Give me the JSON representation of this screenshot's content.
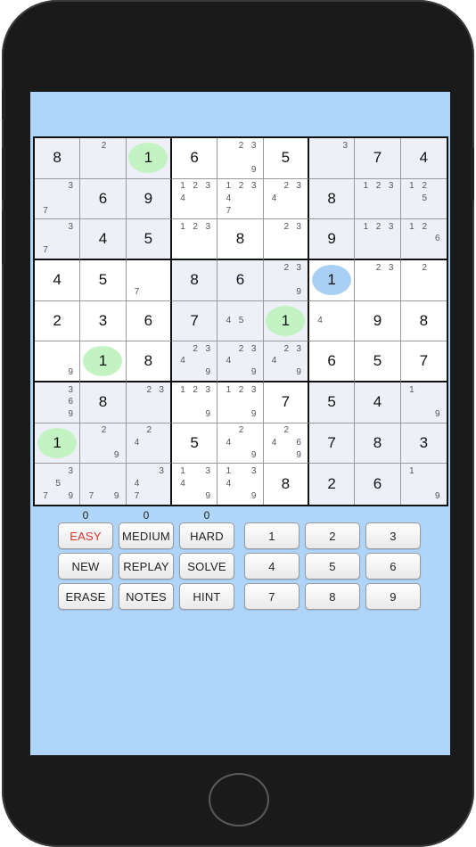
{
  "puzzle": {
    "rows": [
      [
        {
          "v": "8",
          "s": 1
        },
        {
          "n": [
            "",
            "2",
            "",
            "",
            "",
            "",
            "",
            "",
            ""
          ],
          "s": 1
        },
        {
          "v": "1",
          "h": "green",
          "s": 1
        },
        {
          "v": "6"
        },
        {
          "n": [
            "",
            "2",
            "3",
            "",
            "",
            "",
            "",
            "",
            "9"
          ]
        },
        {
          "v": "5"
        },
        {
          "n": [
            "",
            "",
            "3",
            "",
            "",
            "",
            "",
            "",
            ""
          ],
          "s": 1
        },
        {
          "v": "7",
          "s": 1
        },
        {
          "v": "4",
          "s": 1
        }
      ],
      [
        {
          "n": [
            "",
            "",
            "3",
            "",
            "",
            "",
            "7",
            "",
            ""
          ],
          "s": 1
        },
        {
          "v": "6",
          "s": 1
        },
        {
          "v": "9",
          "s": 1
        },
        {
          "n": [
            "1",
            "2",
            "3",
            "4",
            "",
            "",
            "",
            "",
            ""
          ]
        },
        {
          "n": [
            "1",
            "2",
            "3",
            "4",
            "",
            "",
            "7",
            "",
            ""
          ]
        },
        {
          "n": [
            "",
            "2",
            "3",
            "4",
            "",
            "",
            "",
            "",
            ""
          ]
        },
        {
          "v": "8",
          "s": 1
        },
        {
          "n": [
            "1",
            "2",
            "3",
            "",
            "",
            "",
            "",
            "",
            ""
          ],
          "s": 1
        },
        {
          "n": [
            "1",
            "2",
            "",
            "",
            "5",
            "",
            "",
            "",
            ""
          ],
          "s": 1
        }
      ],
      [
        {
          "n": [
            "",
            "",
            "3",
            "",
            "",
            "",
            "7",
            "",
            ""
          ],
          "s": 1
        },
        {
          "v": "4",
          "s": 1
        },
        {
          "v": "5",
          "s": 1
        },
        {
          "n": [
            "1",
            "2",
            "3",
            "",
            "",
            "",
            "",
            "",
            ""
          ]
        },
        {
          "v": "8"
        },
        {
          "n": [
            "",
            "2",
            "3",
            "",
            "",
            "",
            "",
            "",
            ""
          ]
        },
        {
          "v": "9",
          "s": 1
        },
        {
          "n": [
            "1",
            "2",
            "3",
            "",
            "",
            "",
            "",
            "",
            ""
          ],
          "s": 1
        },
        {
          "n": [
            "1",
            "2",
            "",
            "",
            "",
            "6",
            "",
            "",
            ""
          ],
          "s": 1
        }
      ],
      [
        {
          "v": "4"
        },
        {
          "v": "5"
        },
        {
          "n": [
            "",
            "",
            "",
            "",
            "",
            "",
            "7",
            "",
            ""
          ]
        },
        {
          "v": "8",
          "s": 1
        },
        {
          "v": "6",
          "s": 1
        },
        {
          "n": [
            "",
            "2",
            "3",
            "",
            "",
            "",
            "",
            "",
            "9"
          ],
          "s": 1
        },
        {
          "v": "1",
          "h": "blue"
        },
        {
          "n": [
            "",
            "2",
            "3",
            "",
            "",
            "",
            "",
            "",
            ""
          ]
        },
        {
          "n": [
            "",
            "2",
            "",
            "",
            "",
            "",
            "",
            "",
            ""
          ]
        }
      ],
      [
        {
          "v": "2"
        },
        {
          "v": "3"
        },
        {
          "v": "6"
        },
        {
          "v": "7",
          "s": 1
        },
        {
          "n": [
            "",
            "",
            "",
            "4",
            "5",
            "",
            "",
            "",
            ""
          ],
          "s": 1
        },
        {
          "v": "1",
          "h": "green",
          "s": 1
        },
        {
          "n": [
            "",
            "",
            "",
            "4",
            "",
            "",
            "",
            "",
            ""
          ]
        },
        {
          "v": "9"
        },
        {
          "v": "8"
        }
      ],
      [
        {
          "n": [
            "",
            "",
            "",
            "",
            "",
            "",
            "",
            "",
            "9"
          ]
        },
        {
          "v": "1",
          "h": "green"
        },
        {
          "v": "8"
        },
        {
          "n": [
            "",
            "2",
            "3",
            "4",
            "",
            "",
            "",
            "",
            "9"
          ],
          "s": 1
        },
        {
          "n": [
            "",
            "2",
            "3",
            "4",
            "",
            "",
            "",
            "",
            "9"
          ],
          "s": 1
        },
        {
          "n": [
            "",
            "2",
            "3",
            "4",
            "",
            "",
            "",
            "",
            "9"
          ],
          "s": 1
        },
        {
          "v": "6"
        },
        {
          "v": "5"
        },
        {
          "v": "7"
        }
      ],
      [
        {
          "n": [
            "",
            "",
            "3",
            "",
            "",
            "6",
            "",
            "",
            "9"
          ],
          "s": 1
        },
        {
          "v": "8",
          "s": 1
        },
        {
          "n": [
            "",
            "2",
            "3",
            "",
            "",
            "",
            "",
            "",
            ""
          ],
          "s": 1
        },
        {
          "n": [
            "1",
            "2",
            "3",
            "",
            "",
            "",
            "",
            "",
            "9"
          ]
        },
        {
          "n": [
            "1",
            "2",
            "3",
            "",
            "",
            "",
            "",
            "",
            "9"
          ]
        },
        {
          "v": "7"
        },
        {
          "v": "5",
          "s": 1
        },
        {
          "v": "4",
          "s": 1
        },
        {
          "n": [
            "1",
            "",
            "",
            "",
            "",
            "",
            "",
            "",
            "9"
          ],
          "s": 1
        }
      ],
      [
        {
          "v": "1",
          "h": "green",
          "s": 1
        },
        {
          "n": [
            "",
            "2",
            "",
            "",
            "",
            "",
            "",
            "",
            "9"
          ],
          "s": 1
        },
        {
          "n": [
            "",
            "2",
            "",
            "4",
            "",
            "",
            "",
            "",
            ""
          ],
          "s": 1
        },
        {
          "v": "5"
        },
        {
          "n": [
            "",
            "2",
            "",
            "4",
            "",
            "",
            "",
            "",
            "9"
          ]
        },
        {
          "n": [
            "",
            "2",
            "",
            "4",
            "",
            "6",
            "",
            "",
            "9"
          ]
        },
        {
          "v": "7",
          "s": 1
        },
        {
          "v": "8",
          "s": 1
        },
        {
          "v": "3",
          "s": 1
        }
      ],
      [
        {
          "n": [
            "",
            "",
            "3",
            "",
            "5",
            "",
            "7",
            "",
            "9"
          ],
          "s": 1
        },
        {
          "n": [
            "",
            "",
            "",
            "",
            "",
            "",
            "7",
            "",
            "9"
          ],
          "s": 1
        },
        {
          "n": [
            "",
            "",
            "3",
            "4",
            "",
            "",
            "7",
            "",
            ""
          ],
          "s": 1
        },
        {
          "n": [
            "1",
            "",
            "3",
            "4",
            "",
            "",
            "",
            "",
            "9"
          ]
        },
        {
          "n": [
            "1",
            "",
            "3",
            "4",
            "",
            "",
            "",
            "",
            "9"
          ]
        },
        {
          "v": "8"
        },
        {
          "v": "2",
          "s": 1
        },
        {
          "v": "6",
          "s": 1
        },
        {
          "n": [
            "1",
            "",
            "",
            "",
            "",
            "",
            "",
            "",
            "9"
          ],
          "s": 1
        }
      ]
    ]
  },
  "counters": {
    "easy": "0",
    "medium": "0",
    "hard": "0"
  },
  "buttons": {
    "easy": "EASY",
    "medium": "MEDIUM",
    "hard": "HARD",
    "new": "NEW",
    "replay": "REPLAY",
    "solve": "SOLVE",
    "erase": "ERASE",
    "notes": "NOTES",
    "hint": "HINT"
  },
  "number_pad": [
    "1",
    "2",
    "3",
    "4",
    "5",
    "6",
    "7",
    "8",
    "9"
  ],
  "colors": {
    "screen_background": "#afd5f9",
    "shaded_cell": "#eef0f7",
    "highlight_green": "#c3f3c3",
    "highlight_blue": "#a9cff5",
    "easy_label": "#d8342c"
  }
}
